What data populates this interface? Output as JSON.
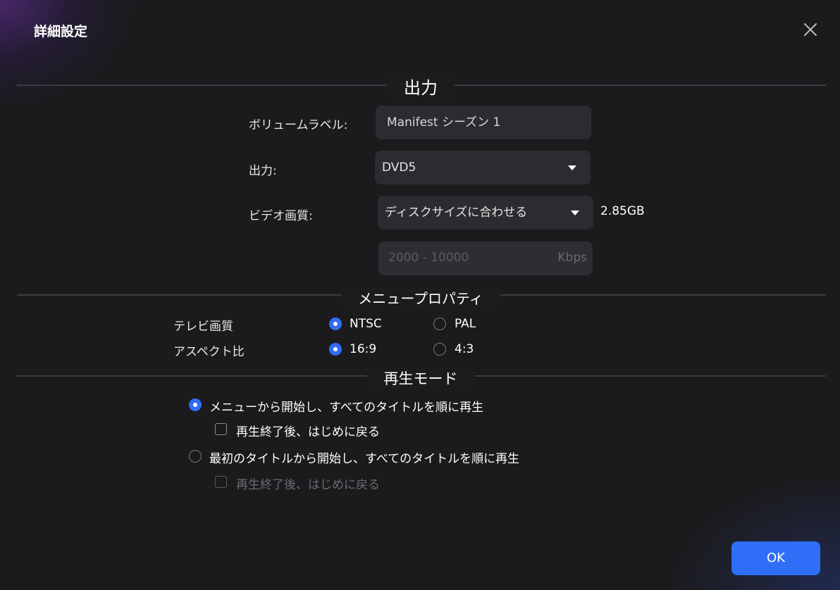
{
  "dialog": {
    "title": "詳細設定",
    "close_icon": "close-icon"
  },
  "output_section": {
    "heading": "出力",
    "volume_label": {
      "label": "ボリュームラベル:",
      "value": "Manifest シーズン 1"
    },
    "output": {
      "label": "出力:",
      "selected": "DVD5"
    },
    "video_quality": {
      "label": "ビデオ画質:",
      "selected": "ディスクサイズに合わせる",
      "size": "2.85GB"
    },
    "bitrate": {
      "placeholder": "2000 - 10000",
      "unit": "Kbps"
    }
  },
  "menu_section": {
    "heading": "メニュープロパティ",
    "tv_standard": {
      "label": "テレビ画質",
      "options": [
        {
          "label": "NTSC",
          "selected": true
        },
        {
          "label": "PAL",
          "selected": false
        }
      ]
    },
    "aspect_ratio": {
      "label": "アスペクト比",
      "options": [
        {
          "label": "16:9",
          "selected": true
        },
        {
          "label": "4:3",
          "selected": false
        }
      ]
    }
  },
  "playback_section": {
    "heading": "再生モード",
    "options": [
      {
        "label": "メニューから開始し、すべてのタイトルを順に再生",
        "selected": true,
        "checkbox": {
          "label": "再生終了後、はじめに戻る",
          "checked": false,
          "enabled": true
        }
      },
      {
        "label": "最初のタイトルから開始し、すべてのタイトルを順に再生",
        "selected": false,
        "checkbox": {
          "label": "再生終了後、はじめに戻る",
          "checked": false,
          "enabled": false
        }
      }
    ]
  },
  "footer": {
    "ok_label": "OK"
  },
  "colors": {
    "accent": "#2f6ef6",
    "background": "#1b1b1e",
    "field_background": "#2c2c30"
  }
}
